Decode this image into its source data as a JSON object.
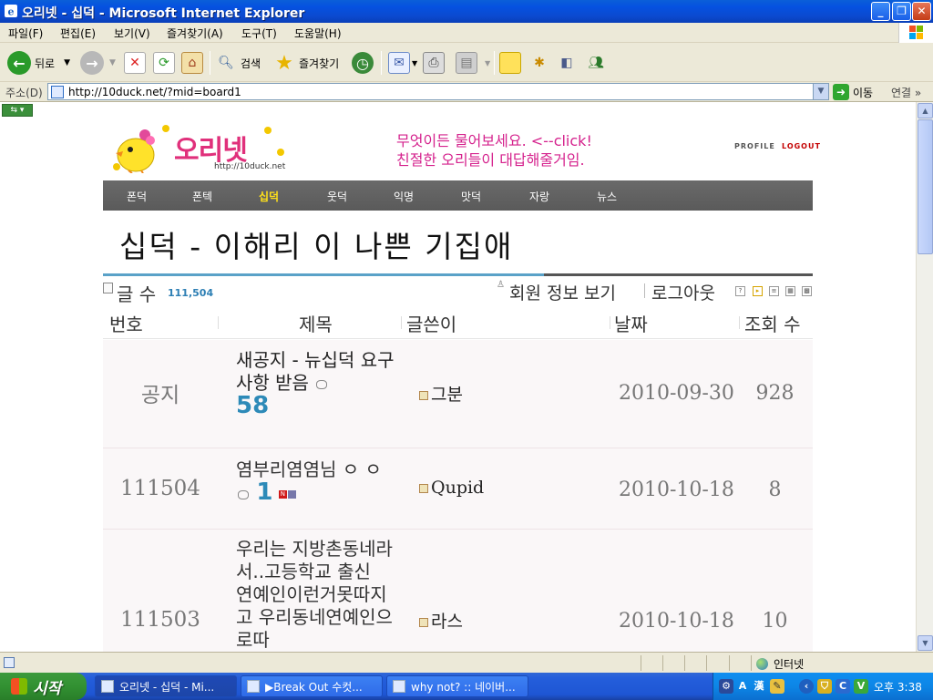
{
  "window": {
    "title": "오리넷 - 십덕 - Microsoft Internet Explorer"
  },
  "menu": [
    "파일(F)",
    "편집(E)",
    "보기(V)",
    "즐겨찾기(A)",
    "도구(T)",
    "도움말(H)"
  ],
  "toolbar": {
    "back": "뒤로",
    "search": "검색",
    "favorites": "즐겨찾기"
  },
  "address": {
    "label": "주소(D)",
    "url": "http://10duck.net/?mid=board1",
    "go": "이동",
    "links": "연결"
  },
  "site": {
    "logo_text": "오리넷",
    "logo_url": "http://10duck.net",
    "banner_line1": "무엇이든 물어보세요. <--click!",
    "banner_line2": "친절한 오리들이 대답해줄거임.",
    "profile": "PROFILE",
    "logout": "LOGOUT"
  },
  "nav": [
    "폰덕",
    "폰텍",
    "십덕",
    "웃덕",
    "익명",
    "맛덕",
    "자랑",
    "뉴스"
  ],
  "nav_active": "십덕",
  "board": {
    "title": "십덕 - 이해리 이 나쁜 기집애",
    "count_label": "글 수",
    "count_value": "111,504",
    "member_info": "회원 정보 보기",
    "logout": "로그아웃"
  },
  "columns": {
    "no": "번호",
    "subject": "제목",
    "writer": "글쓴이",
    "date": "날짜",
    "views": "조회 수"
  },
  "rows": [
    {
      "no": "공지",
      "subject": "새공지 - 뉴십덕 요구사항 받음",
      "comments": "58",
      "writer": "그분",
      "date": "2010-09-30",
      "views": "928"
    },
    {
      "no": "111504",
      "subject": "염부리염염님 ㅇ ㅇ",
      "comments": "1",
      "writer": "Qupid",
      "date": "2010-10-18",
      "views": "8"
    },
    {
      "no": "111503",
      "subject": "우리는 지방촌동네라서..고등학교 출신 연예인이런거못따지고 우리동네연예인으로따",
      "writer": "라스",
      "date": "2010-10-18",
      "views": "10"
    }
  ],
  "status": {
    "zone": "인터넷"
  },
  "taskbar": {
    "start": "시작",
    "tasks": [
      "오리넷 - 십덕 - Mi...",
      "▶Break Out 수컷...",
      "why not? :: 네이버..."
    ],
    "clock": "오후 3:38"
  }
}
